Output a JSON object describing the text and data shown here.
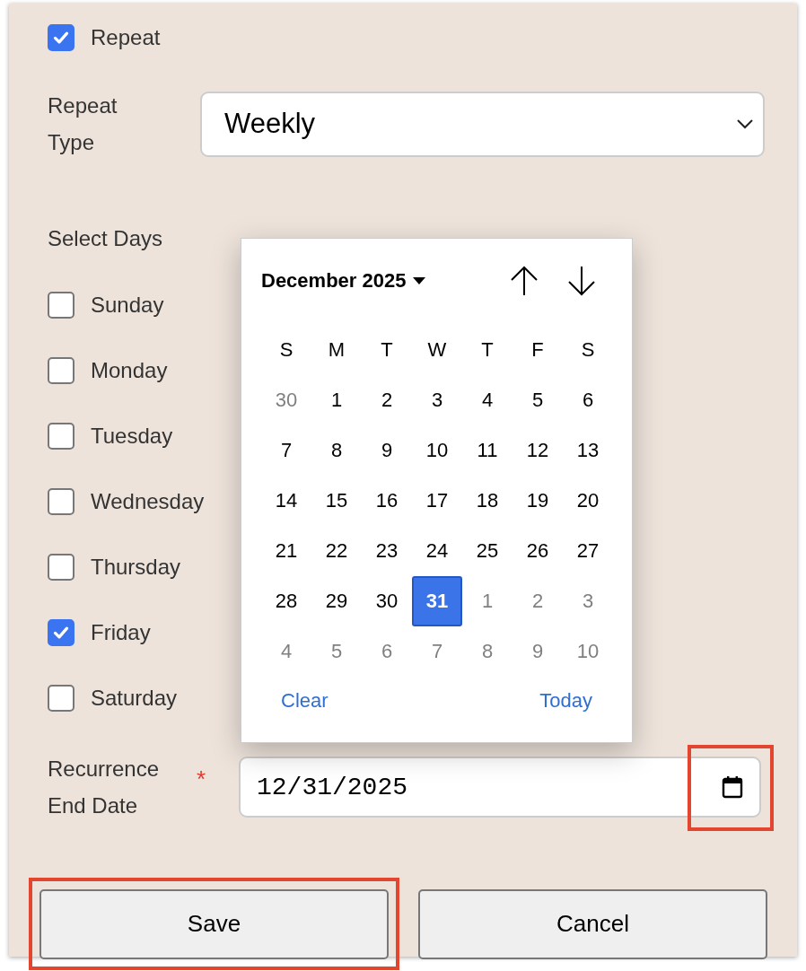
{
  "repeat": {
    "label": "Repeat",
    "checked": true
  },
  "repeat_type": {
    "label": "Repeat Type",
    "value": "Weekly"
  },
  "select_days": {
    "label": "Select Days",
    "days": [
      {
        "label": "Sunday",
        "checked": false
      },
      {
        "label": "Monday",
        "checked": false
      },
      {
        "label": "Tuesday",
        "checked": false
      },
      {
        "label": "Wednesday",
        "checked": false
      },
      {
        "label": "Thursday",
        "checked": false
      },
      {
        "label": "Friday",
        "checked": true
      },
      {
        "label": "Saturday",
        "checked": false
      }
    ]
  },
  "end_date": {
    "label": "Recurrence End Date",
    "required_mark": "*",
    "value": "12/31/2025",
    "picker_button_highlighted": true
  },
  "calendar": {
    "month": "December 2025",
    "weekdays": [
      "S",
      "M",
      "T",
      "W",
      "T",
      "F",
      "S"
    ],
    "weeks": [
      [
        {
          "label": "30",
          "outside": true,
          "selected": false
        },
        {
          "label": "1",
          "outside": false,
          "selected": false
        },
        {
          "label": "2",
          "outside": false,
          "selected": false
        },
        {
          "label": "3",
          "outside": false,
          "selected": false
        },
        {
          "label": "4",
          "outside": false,
          "selected": false
        },
        {
          "label": "5",
          "outside": false,
          "selected": false
        },
        {
          "label": "6",
          "outside": false,
          "selected": false
        }
      ],
      [
        {
          "label": "7",
          "outside": false,
          "selected": false
        },
        {
          "label": "8",
          "outside": false,
          "selected": false
        },
        {
          "label": "9",
          "outside": false,
          "selected": false
        },
        {
          "label": "10",
          "outside": false,
          "selected": false
        },
        {
          "label": "11",
          "outside": false,
          "selected": false
        },
        {
          "label": "12",
          "outside": false,
          "selected": false
        },
        {
          "label": "13",
          "outside": false,
          "selected": false
        }
      ],
      [
        {
          "label": "14",
          "outside": false,
          "selected": false
        },
        {
          "label": "15",
          "outside": false,
          "selected": false
        },
        {
          "label": "16",
          "outside": false,
          "selected": false
        },
        {
          "label": "17",
          "outside": false,
          "selected": false
        },
        {
          "label": "18",
          "outside": false,
          "selected": false
        },
        {
          "label": "19",
          "outside": false,
          "selected": false
        },
        {
          "label": "20",
          "outside": false,
          "selected": false
        }
      ],
      [
        {
          "label": "21",
          "outside": false,
          "selected": false
        },
        {
          "label": "22",
          "outside": false,
          "selected": false
        },
        {
          "label": "23",
          "outside": false,
          "selected": false
        },
        {
          "label": "24",
          "outside": false,
          "selected": false
        },
        {
          "label": "25",
          "outside": false,
          "selected": false
        },
        {
          "label": "26",
          "outside": false,
          "selected": false
        },
        {
          "label": "27",
          "outside": false,
          "selected": false
        }
      ],
      [
        {
          "label": "28",
          "outside": false,
          "selected": false
        },
        {
          "label": "29",
          "outside": false,
          "selected": false
        },
        {
          "label": "30",
          "outside": false,
          "selected": false
        },
        {
          "label": "31",
          "outside": false,
          "selected": true
        },
        {
          "label": "1",
          "outside": true,
          "selected": false
        },
        {
          "label": "2",
          "outside": true,
          "selected": false
        },
        {
          "label": "3",
          "outside": true,
          "selected": false
        }
      ],
      [
        {
          "label": "4",
          "outside": true,
          "selected": false
        },
        {
          "label": "5",
          "outside": true,
          "selected": false
        },
        {
          "label": "6",
          "outside": true,
          "selected": false
        },
        {
          "label": "7",
          "outside": true,
          "selected": false
        },
        {
          "label": "8",
          "outside": true,
          "selected": false
        },
        {
          "label": "9",
          "outside": true,
          "selected": false
        },
        {
          "label": "10",
          "outside": true,
          "selected": false
        }
      ]
    ],
    "clear": "Clear",
    "today": "Today"
  },
  "buttons": [
    {
      "label": "Save",
      "highlighted": true
    },
    {
      "label": "Cancel",
      "highlighted": false
    }
  ]
}
